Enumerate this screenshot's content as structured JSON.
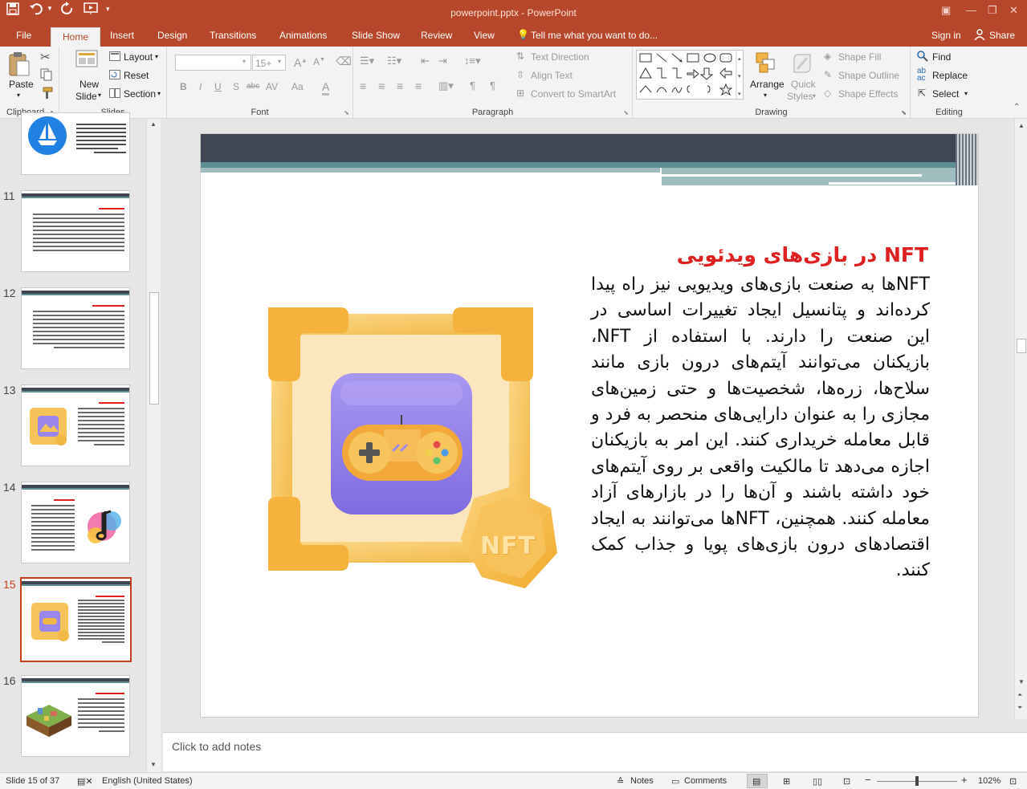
{
  "window": {
    "title": "powerpoint.pptx - PowerPoint"
  },
  "tabs": [
    "File",
    "Home",
    "Insert",
    "Design",
    "Transitions",
    "Animations",
    "Slide Show",
    "Review",
    "View"
  ],
  "tell_me": "Tell me what you want to do...",
  "account": {
    "sign_in": "Sign in",
    "share": "Share"
  },
  "ribbon": {
    "clipboard": {
      "paste": "Paste",
      "label": "Clipboard"
    },
    "slides": {
      "new_slide": "New",
      "new_slide2": "Slide",
      "layout": "Layout",
      "reset": "Reset",
      "section": "Section",
      "label": "Slides"
    },
    "font": {
      "size": "15+",
      "label": "Font",
      "bold": "B",
      "italic": "I",
      "underline": "U",
      "strike": "S",
      "abc": "abc",
      "av": "AV",
      "aa": "Aa",
      "a": "A"
    },
    "paragraph": {
      "text_direction": "Text Direction",
      "align_text": "Align Text",
      "smartart": "Convert to SmartArt",
      "label": "Paragraph"
    },
    "drawing": {
      "arrange": "Arrange",
      "quick_styles": "Quick",
      "quick_styles2": "Styles",
      "shape_fill": "Shape Fill",
      "shape_outline": "Shape Outline",
      "shape_effects": "Shape Effects",
      "label": "Drawing"
    },
    "editing": {
      "find": "Find",
      "replace": "Replace",
      "select": "Select",
      "label": "Editing"
    }
  },
  "thumbnails": [
    {
      "num": "11"
    },
    {
      "num": "12"
    },
    {
      "num": "13"
    },
    {
      "num": "14"
    },
    {
      "num": "15"
    },
    {
      "num": "16"
    }
  ],
  "slide": {
    "heading": "NFT در بازی‌های ویدئویی",
    "body": "NFTها به صنعت بازی‌های ویدیویی نیز راه پیدا کرده‌اند و پتانسیل ایجاد تغییرات اساسی در این صنعت را دارند. با استفاده از NFT، بازیکنان می‌توانند آیتم‌های درون بازی مانند سلاح‌ها، زره‌ها، شخصیت‌ها و حتی زمین‌های مجازی را به عنوان دارایی‌های منحصر به فرد و قابل معامله خریداری کنند. این امر به بازیکنان اجازه می‌دهد تا مالکیت واقعی بر روی آیتم‌های خود داشته باشند و آن‌ها را در بازارهای آزاد معامله کنند. همچنین، NFTها می‌توانند به ایجاد اقتصادهای درون بازی‌های پویا و جذاب کمک کنند.",
    "badge": "NFT"
  },
  "notes_placeholder": "Click to add notes",
  "status": {
    "slide_info": "Slide 15 of 37",
    "language": "English (United States)",
    "notes": "Notes",
    "comments": "Comments",
    "zoom": "102%"
  },
  "colors": {
    "brand": "#b7472a",
    "selected": "#c4401f",
    "heading": "#e02020",
    "frame": "#f2b845",
    "screen": "#8e7ce8"
  }
}
